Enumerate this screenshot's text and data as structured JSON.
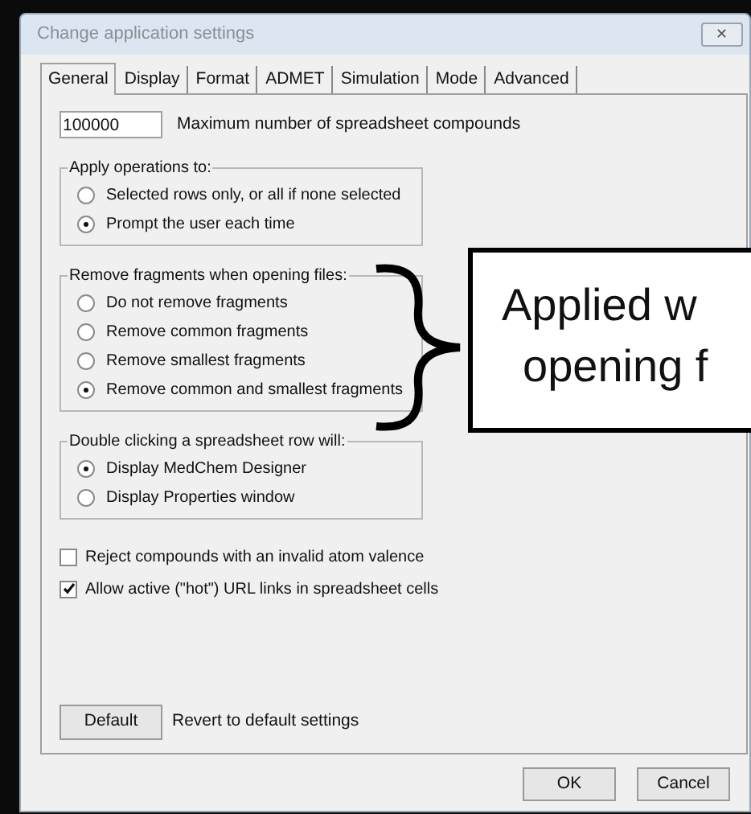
{
  "window": {
    "title": "Change application settings",
    "close": "✕"
  },
  "tabs": [
    {
      "label": "General",
      "selected": true
    },
    {
      "label": "Display",
      "selected": false
    },
    {
      "label": "Format",
      "selected": false
    },
    {
      "label": "ADMET",
      "selected": false
    },
    {
      "label": "Simulation",
      "selected": false
    },
    {
      "label": "Mode",
      "selected": false
    },
    {
      "label": "Advanced",
      "selected": false
    }
  ],
  "max_compounds": {
    "value": "100000",
    "label": "Maximum number of spreadsheet compounds"
  },
  "groups": [
    {
      "title": "Apply operations to:",
      "options": [
        {
          "label": "Selected rows only, or all if none selected",
          "selected": false
        },
        {
          "label": "Prompt the user each time",
          "selected": true
        }
      ]
    },
    {
      "title": "Remove fragments when opening files:",
      "options": [
        {
          "label": "Do not remove fragments",
          "selected": false
        },
        {
          "label": "Remove common fragments",
          "selected": false
        },
        {
          "label": "Remove smallest fragments",
          "selected": false
        },
        {
          "label": "Remove common and smallest fragments",
          "selected": true
        }
      ]
    },
    {
      "title": "Double clicking a spreadsheet row will:",
      "options": [
        {
          "label": "Display MedChem Designer",
          "selected": true
        },
        {
          "label": "Display Properties window",
          "selected": false
        }
      ]
    }
  ],
  "checkboxes": [
    {
      "label": "Reject compounds with an invalid atom valence",
      "checked": false
    },
    {
      "label": "Allow active (\"hot\") URL links in spreadsheet cells",
      "checked": true
    }
  ],
  "default_button": {
    "label": "Default",
    "description": "Revert to default settings"
  },
  "buttons": [
    "OK",
    "Cancel"
  ],
  "callout": {
    "lines": [
      "Applied w",
      "opening f"
    ]
  }
}
